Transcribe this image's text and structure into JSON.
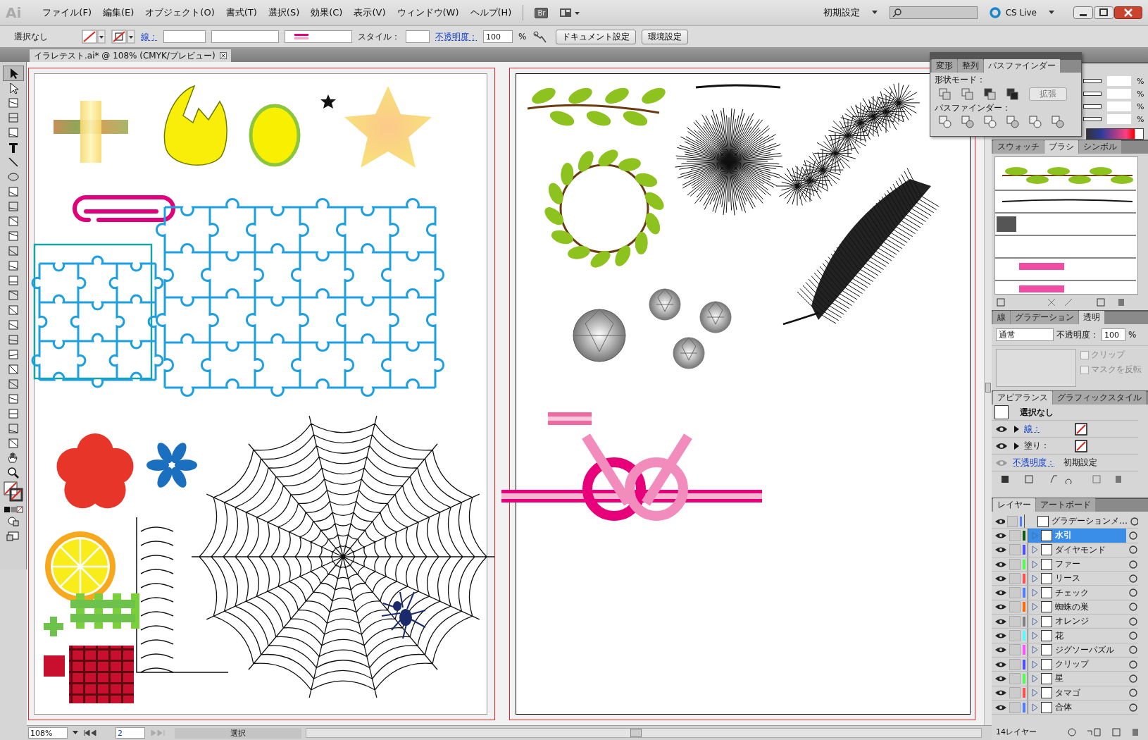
{
  "app": {
    "logo": "Ai"
  },
  "menu_bar": {
    "items": [
      "ファイル(F)",
      "編集(E)",
      "オブジェクト(O)",
      "書式(T)",
      "選択(S)",
      "効果(C)",
      "表示(V)",
      "ウィンドウ(W)",
      "ヘルプ(H)"
    ],
    "bridge_button": "Br",
    "workspace": "初期設定",
    "cs_live": "CS Live"
  },
  "control_bar": {
    "selection": "選択なし",
    "stroke_label": "線：",
    "style_label": "スタイル：",
    "opacity_label": "不透明度：",
    "opacity": "100",
    "opacity_unit": "%",
    "buttons": [
      "ドキュメント設定",
      "環境設定"
    ]
  },
  "document_tab": {
    "title": "イラレテスト.ai* @ 108% (CMYK/プレビュー)"
  },
  "pathfinder_panel": {
    "tabs": [
      {
        "label": "変形",
        "selected": false
      },
      {
        "label": "整列",
        "selected": false
      },
      {
        "label": "パスファインダー",
        "selected": true
      }
    ],
    "shape_modes_label": "形状モード：",
    "expand_button": "拡張",
    "pathfinders_label": "パスファインダー："
  },
  "color_panel": {
    "units": [
      "%",
      "%",
      "%",
      "%"
    ]
  },
  "brushes_panel": {
    "tabs": [
      {
        "label": "スウォッチ",
        "selected": false
      },
      {
        "label": "ブラシ",
        "selected": true
      },
      {
        "label": "シンボル",
        "selected": false
      }
    ]
  },
  "transparency_panel": {
    "tabs": [
      {
        "label": "線",
        "selected": false
      },
      {
        "label": "グラデーション",
        "selected": false
      },
      {
        "label": "透明",
        "selected": true
      }
    ],
    "blend_mode": "通常",
    "opacity_label": "不透明度：",
    "opacity": "100",
    "opacity_unit": "%",
    "options": [
      {
        "label": "クリップ",
        "checked": false
      },
      {
        "label": "マスクを反転",
        "checked": false
      }
    ]
  },
  "appearance_panel": {
    "tabs": [
      {
        "label": "アピアランス",
        "selected": true
      },
      {
        "label": "グラフィックスタイル",
        "selected": false
      }
    ],
    "header": "選択なし",
    "rows": [
      {
        "kind": "stroke",
        "label": "線：",
        "link": true
      },
      {
        "kind": "fill",
        "label": "塗り：",
        "link": false
      },
      {
        "kind": "opacity",
        "label": "不透明度：",
        "link": true,
        "value": "初期設定"
      }
    ]
  },
  "layers_panel": {
    "tabs": [
      {
        "label": "レイヤー",
        "selected": true
      },
      {
        "label": "アートボード",
        "selected": false
      }
    ],
    "layers": [
      {
        "name": "グラデーションメ…",
        "color": "#4f7fff",
        "selected": false,
        "has_children": false
      },
      {
        "name": "水引",
        "color": "#0b5a0b",
        "selected": true,
        "has_children": true
      },
      {
        "name": "ダイヤモンド",
        "color": "#4f4fff",
        "selected": false,
        "has_children": true
      },
      {
        "name": "ファー",
        "color": "#4fff4f",
        "selected": false,
        "has_children": true
      },
      {
        "name": "リース",
        "color": "#ff4f4f",
        "selected": false,
        "has_children": true
      },
      {
        "name": "チェック",
        "color": "#4f7fff",
        "selected": false,
        "has_children": true
      },
      {
        "name": "蜘蛛の巣",
        "color": "#ff6a00",
        "selected": false,
        "has_children": true
      },
      {
        "name": "オレンジ",
        "color": "#808080",
        "selected": false,
        "has_children": true
      },
      {
        "name": "花",
        "color": "#4fffff",
        "selected": false,
        "has_children": true
      },
      {
        "name": "ジグソーパズル",
        "color": "#ff4fff",
        "selected": false,
        "has_children": true
      },
      {
        "name": "クリップ",
        "color": "#4f4fff",
        "selected": false,
        "has_children": true
      },
      {
        "name": "星",
        "color": "#4fff4f",
        "selected": false,
        "has_children": true
      },
      {
        "name": "タマゴ",
        "color": "#ff4f4f",
        "selected": false,
        "has_children": true
      },
      {
        "name": "合体",
        "color": "#4f7fff",
        "selected": false,
        "has_children": true
      }
    ],
    "footer": "14レイヤー"
  },
  "status_bar": {
    "zoom": "108%",
    "artboard": "2",
    "status": "選択"
  }
}
